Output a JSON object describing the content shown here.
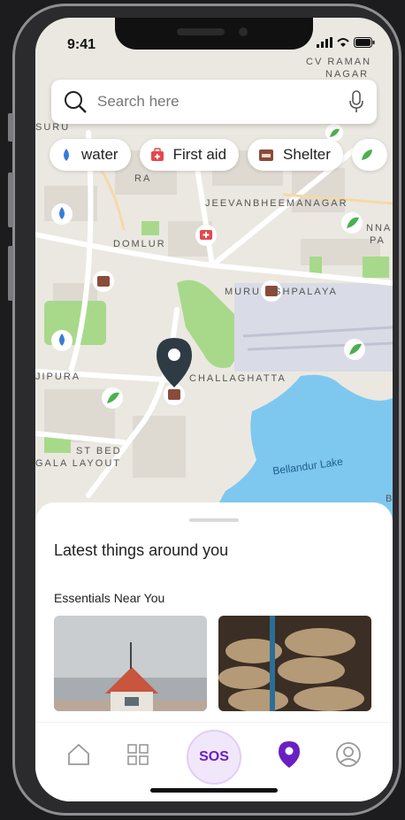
{
  "status": {
    "time": "9:41"
  },
  "search": {
    "placeholder": "Search here"
  },
  "chips": [
    {
      "label": "water",
      "icon": "water-drop-icon"
    },
    {
      "label": "First aid",
      "icon": "first-aid-kit-icon"
    },
    {
      "label": "Shelter",
      "icon": "bed-icon"
    }
  ],
  "map": {
    "labels": {
      "cv_raman": "CV RAMAN",
      "nagar": "NAGAR",
      "suru": "SURU",
      "ra": "RA",
      "jeevan": "JEEVANBHEEMANAGAR",
      "nna": "NNA",
      "pa": "PA",
      "domlur": "DOMLUR",
      "murugesh": "MURU   SHPALAYA",
      "jipura": "JIPURA",
      "challaghatta": "CHALLAGHATTA",
      "st_bed": "ST BED",
      "gala_layout": "GALA LAYOUT",
      "bellandur": "Bellandur Lake",
      "b": "B"
    }
  },
  "sheet": {
    "title": "Latest things around you",
    "subtitle": "Essentials Near You"
  },
  "tabs": {
    "sos": "SOS"
  },
  "colors": {
    "accent": "#6a1fc4",
    "water": "#3a7bd5",
    "first_aid": "#e5484d",
    "shelter": "#8a4b3a",
    "lake": "#7ec8ef",
    "park": "#a8d98a"
  }
}
